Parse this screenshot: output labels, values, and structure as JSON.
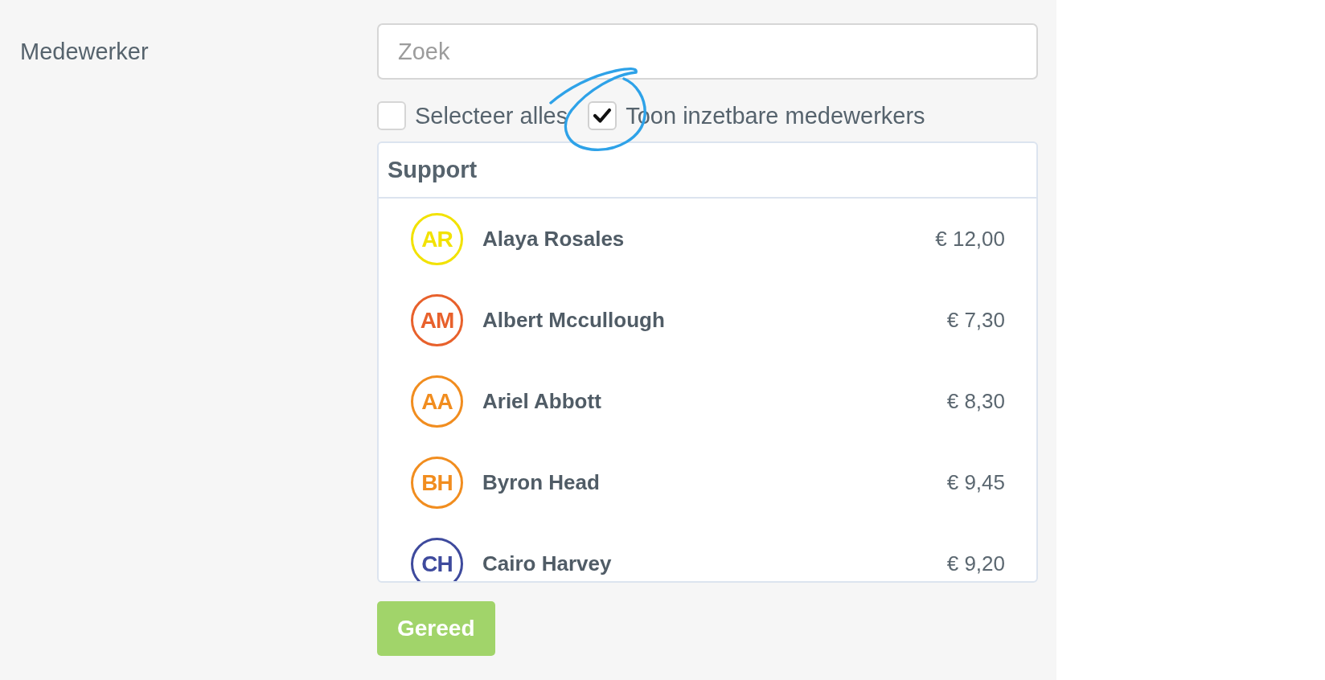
{
  "field": {
    "label": "Medewerker",
    "search": {
      "placeholder": "Zoek"
    }
  },
  "options": [
    {
      "label": "Selecteer alles",
      "checked": false,
      "highlighted": false
    },
    {
      "label": "Toon inzetbare medewerkers",
      "checked": true,
      "highlighted": true
    }
  ],
  "group": {
    "title": "Support",
    "employees": [
      {
        "initials": "AR",
        "name": "Alaya Rosales",
        "rate": "€ 12,00",
        "color": "#f2e200"
      },
      {
        "initials": "AM",
        "name": "Albert Mccullough",
        "rate": "€ 7,30",
        "color": "#e8612c"
      },
      {
        "initials": "AA",
        "name": "Ariel Abbott",
        "rate": "€ 8,30",
        "color": "#f18d1f"
      },
      {
        "initials": "BH",
        "name": "Byron Head",
        "rate": "€ 9,45",
        "color": "#f18d1f"
      },
      {
        "initials": "CH",
        "name": "Cairo Harvey",
        "rate": "€ 9,20",
        "color": "#3e4a9d"
      }
    ]
  },
  "done_button": {
    "label": "Gereed"
  }
}
